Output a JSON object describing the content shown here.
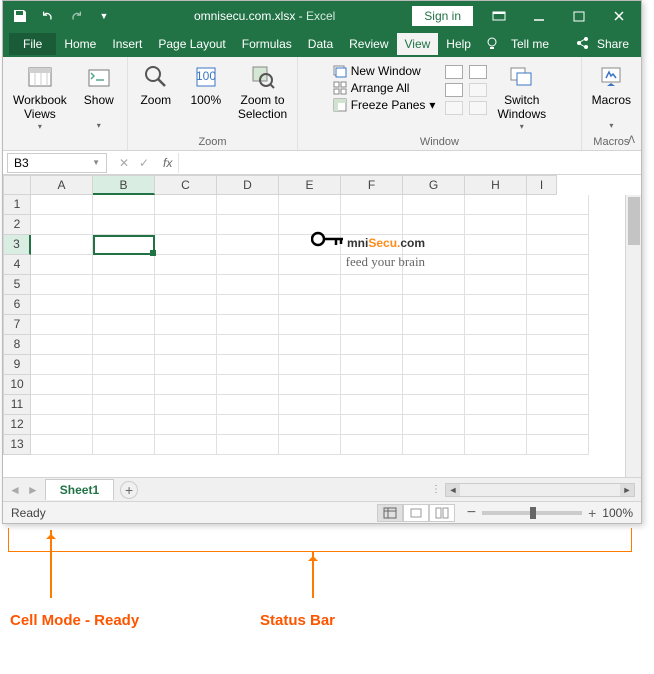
{
  "title": {
    "filename": "omnisecu.com.xlsx",
    "sep": " - ",
    "app": "Excel"
  },
  "signin": "Sign in",
  "tabs": [
    "File",
    "Home",
    "Insert",
    "Page Layout",
    "Formulas",
    "Data",
    "Review",
    "View",
    "Help"
  ],
  "active_tab": "View",
  "tellme": "Tell me",
  "share": "Share",
  "ribbon": {
    "views": {
      "workbook_views": "Workbook\nViews",
      "show": "Show"
    },
    "zoom": {
      "zoom": "Zoom",
      "hundred": "100%",
      "to_sel": "Zoom to\nSelection",
      "label": "Zoom"
    },
    "window": {
      "new_window": "New Window",
      "arrange_all": "Arrange All",
      "freeze": "Freeze Panes",
      "switch": "Switch\nWindows",
      "label": "Window"
    },
    "macros": {
      "macros": "Macros",
      "label": "Macros"
    }
  },
  "namebox": "B3",
  "fx": "fx",
  "columns": [
    "A",
    "B",
    "C",
    "D",
    "E",
    "F",
    "G",
    "H",
    "I"
  ],
  "rows": [
    "1",
    "2",
    "3",
    "4",
    "5",
    "6",
    "7",
    "8",
    "9",
    "10",
    "11",
    "12",
    "13"
  ],
  "selected": {
    "col": "B",
    "row": "3",
    "col_index": 1,
    "row_index": 2
  },
  "watermark": {
    "omni": "mni",
    "secu": "Secu",
    "dot": ".",
    "com": "com",
    "tag": "feed your brain"
  },
  "sheet_tab": "Sheet1",
  "status": {
    "mode": "Ready",
    "zoom": "100%"
  },
  "callouts": {
    "cell_mode": "Cell Mode - Ready",
    "status_bar": "Status Bar"
  }
}
